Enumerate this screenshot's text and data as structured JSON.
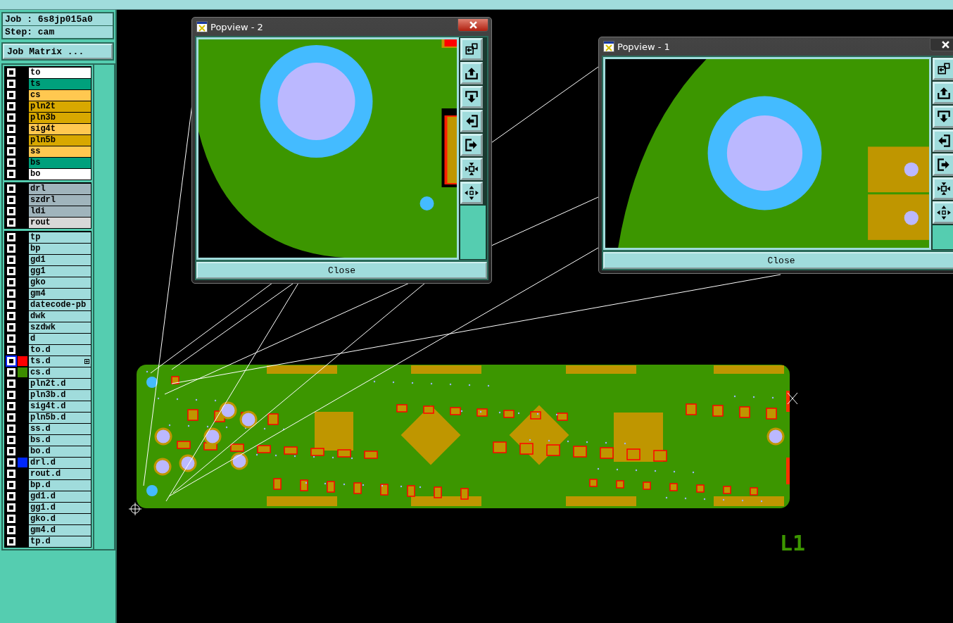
{
  "job": {
    "job_line": "Job : 6s8jp015a0",
    "step_line": "Step: cam",
    "matrix_button": "Job Matrix ..."
  },
  "layer_groups": [
    [
      {
        "name": "to",
        "color": "#ffffff",
        "checked": false,
        "focused": false,
        "marker": false
      },
      {
        "name": "ts",
        "color": "#00a07c",
        "checked": false,
        "focused": false,
        "marker": false
      },
      {
        "name": "cs",
        "color": "#ffc850",
        "checked": false,
        "focused": false,
        "marker": false
      },
      {
        "name": "pln2t",
        "color": "#d8a800",
        "checked": false,
        "focused": false,
        "marker": false
      },
      {
        "name": "pln3b",
        "color": "#d8a800",
        "checked": false,
        "focused": false,
        "marker": false
      },
      {
        "name": "sig4t",
        "color": "#ffc850",
        "checked": false,
        "focused": false,
        "marker": false
      },
      {
        "name": "pln5b",
        "color": "#d8a800",
        "checked": false,
        "focused": false,
        "marker": false
      },
      {
        "name": "ss",
        "color": "#ffc850",
        "checked": false,
        "focused": false,
        "marker": false
      },
      {
        "name": "bs",
        "color": "#00a07c",
        "checked": false,
        "focused": false,
        "marker": false
      },
      {
        "name": "bo",
        "color": "#ffffff",
        "checked": false,
        "focused": false,
        "marker": false
      }
    ],
    [
      {
        "name": "drl",
        "color": "#a0b4bc",
        "checked": false,
        "focused": false,
        "marker": false
      },
      {
        "name": "szdrl",
        "color": "#a0b4bc",
        "checked": false,
        "focused": false,
        "marker": false
      },
      {
        "name": "ldi",
        "color": "#a0b4bc",
        "checked": false,
        "focused": false,
        "marker": false
      },
      {
        "name": "rout",
        "color": "#d8d8d8",
        "checked": false,
        "focused": false,
        "marker": false
      }
    ],
    [
      {
        "name": "tp",
        "color": "#a0dcdc",
        "checked": false,
        "focused": false,
        "marker": false
      },
      {
        "name": "bp",
        "color": "#a0dcdc",
        "checked": false,
        "focused": false,
        "marker": false
      },
      {
        "name": "gd1",
        "color": "#a0dcdc",
        "checked": false,
        "focused": false,
        "marker": false
      },
      {
        "name": "gg1",
        "color": "#a0dcdc",
        "checked": false,
        "focused": false,
        "marker": false
      },
      {
        "name": "gko",
        "color": "#a0dcdc",
        "checked": false,
        "focused": false,
        "marker": false
      },
      {
        "name": "gm4",
        "color": "#a0dcdc",
        "checked": false,
        "focused": false,
        "marker": false
      },
      {
        "name": "datecode-pb",
        "color": "#a0dcdc",
        "checked": false,
        "focused": false,
        "marker": false
      },
      {
        "name": "dwk",
        "color": "#a0dcdc",
        "checked": false,
        "focused": false,
        "marker": false
      },
      {
        "name": "szdwk",
        "color": "#a0dcdc",
        "checked": false,
        "focused": false,
        "marker": false
      },
      {
        "name": "d",
        "color": "#a0dcdc",
        "checked": false,
        "focused": false,
        "marker": false
      },
      {
        "name": "to.d",
        "color": "#a0dcdc",
        "checked": false,
        "focused": false,
        "marker": false
      },
      {
        "name": "ts.d",
        "color": "#a0dcdc",
        "swatch": {
          "color": "#ff0000"
        },
        "checked": false,
        "focused": true,
        "marker": true
      },
      {
        "name": "cs.d",
        "color": "#a0dcdc",
        "swatch": {
          "color": "#3c8c00"
        },
        "checked": false,
        "focused": false,
        "marker": false
      },
      {
        "name": "pln2t.d",
        "color": "#a0dcdc",
        "checked": false,
        "focused": false,
        "marker": false
      },
      {
        "name": "pln3b.d",
        "color": "#a0dcdc",
        "checked": false,
        "focused": false,
        "marker": false
      },
      {
        "name": "sig4t.d",
        "color": "#a0dcdc",
        "checked": false,
        "focused": false,
        "marker": false
      },
      {
        "name": "pln5b.d",
        "color": "#a0dcdc",
        "checked": false,
        "focused": false,
        "marker": false
      },
      {
        "name": "ss.d",
        "color": "#a0dcdc",
        "checked": false,
        "focused": false,
        "marker": false
      },
      {
        "name": "bs.d",
        "color": "#a0dcdc",
        "checked": false,
        "focused": false,
        "marker": false
      },
      {
        "name": "bo.d",
        "color": "#a0dcdc",
        "checked": false,
        "focused": false,
        "marker": false
      },
      {
        "name": "drl.d",
        "color": "#a0dcdc",
        "swatch": {
          "color": "#0028ff"
        },
        "checked": false,
        "focused": false,
        "marker": false
      },
      {
        "name": "rout.d",
        "color": "#a0dcdc",
        "checked": false,
        "focused": false,
        "marker": false
      },
      {
        "name": "bp.d",
        "color": "#a0dcdc",
        "checked": false,
        "focused": false,
        "marker": false
      },
      {
        "name": "gd1.d",
        "color": "#a0dcdc",
        "checked": false,
        "focused": false,
        "marker": false
      },
      {
        "name": "gg1.d",
        "color": "#a0dcdc",
        "checked": false,
        "focused": false,
        "marker": false
      },
      {
        "name": "gko.d",
        "color": "#a0dcdc",
        "checked": false,
        "focused": false,
        "marker": false
      },
      {
        "name": "gm4.d",
        "color": "#a0dcdc",
        "checked": false,
        "focused": false,
        "marker": false
      },
      {
        "name": "tp.d",
        "color": "#a0dcdc",
        "checked": false,
        "focused": false,
        "marker": false
      }
    ]
  ],
  "popviews": [
    {
      "title": "Popview - 2",
      "close_label": "Close",
      "close_highlighted": true,
      "kind": "edge"
    },
    {
      "title": "Popview - 1",
      "close_label": "Close",
      "close_highlighted": false,
      "kind": "corner"
    }
  ],
  "layer_label": "L1"
}
